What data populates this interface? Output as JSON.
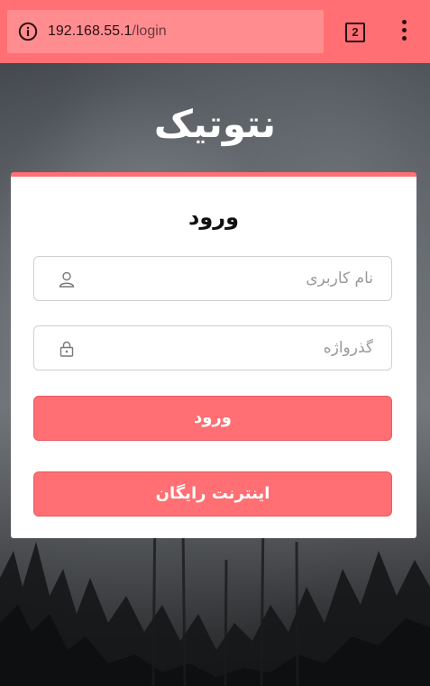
{
  "browser": {
    "url_host": "192.168.55.1",
    "url_path": "/login",
    "tab_count": "2"
  },
  "icons": {
    "info": "info-icon",
    "tabs": "tab-switcher-icon",
    "menu": "more-vertical-icon",
    "user": "user-icon",
    "lock": "lock-icon"
  },
  "colors": {
    "accent": "#ff6f73",
    "toolbar": "#ff6f73",
    "card": "#ffffff"
  },
  "brand": {
    "name": "نتوتیک"
  },
  "login": {
    "title": "ورود",
    "username_placeholder": "نام کاربری",
    "password_placeholder": "گذرواژه",
    "login_button": "ورود",
    "free_internet_button": "اینترنت رایگان"
  }
}
